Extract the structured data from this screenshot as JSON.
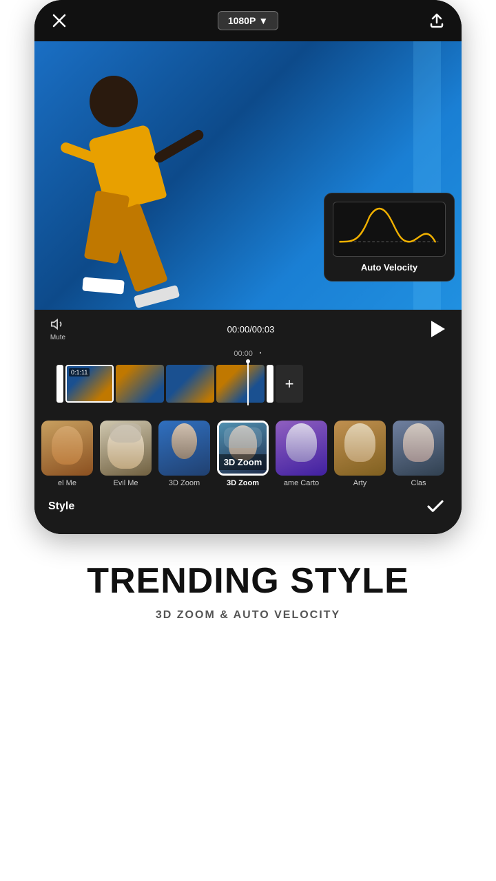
{
  "topBar": {
    "resolution": "1080P",
    "resolutionChevron": "▼"
  },
  "videoPreview": {
    "timeDisplay": "00:00/00:03",
    "timeMarker": "00:00"
  },
  "velocityPopup": {
    "label": "Auto Velocity"
  },
  "timeline": {
    "thumbTime": "0:1:11",
    "addLabel": "+",
    "muteLabel": "Mute"
  },
  "stylePicker": {
    "items": [
      {
        "id": 1,
        "label": "el Me",
        "bgClass": "style-bg-1",
        "selected": false
      },
      {
        "id": 2,
        "label": "Evil Me",
        "bgClass": "style-bg-2",
        "selected": false
      },
      {
        "id": 3,
        "label": "3D Zoom",
        "bgClass": "style-bg-3",
        "selected": false
      },
      {
        "id": 4,
        "label": "3D Zoom",
        "bgClass": "style-bg-4",
        "selected": true
      },
      {
        "id": 5,
        "label": "ame Carto",
        "bgClass": "style-bg-5",
        "selected": false
      },
      {
        "id": 6,
        "label": "Arty",
        "bgClass": "style-bg-6",
        "selected": false
      },
      {
        "id": 7,
        "label": "Clas",
        "bgClass": "style-bg-7",
        "selected": false
      }
    ],
    "selectedLabel": "3D Zoom",
    "sectionTitle": "Style"
  },
  "bottomSection": {
    "title": "TRENDING STYLE",
    "subtitle": "3D ZOOM & AUTO VELOCITY"
  }
}
